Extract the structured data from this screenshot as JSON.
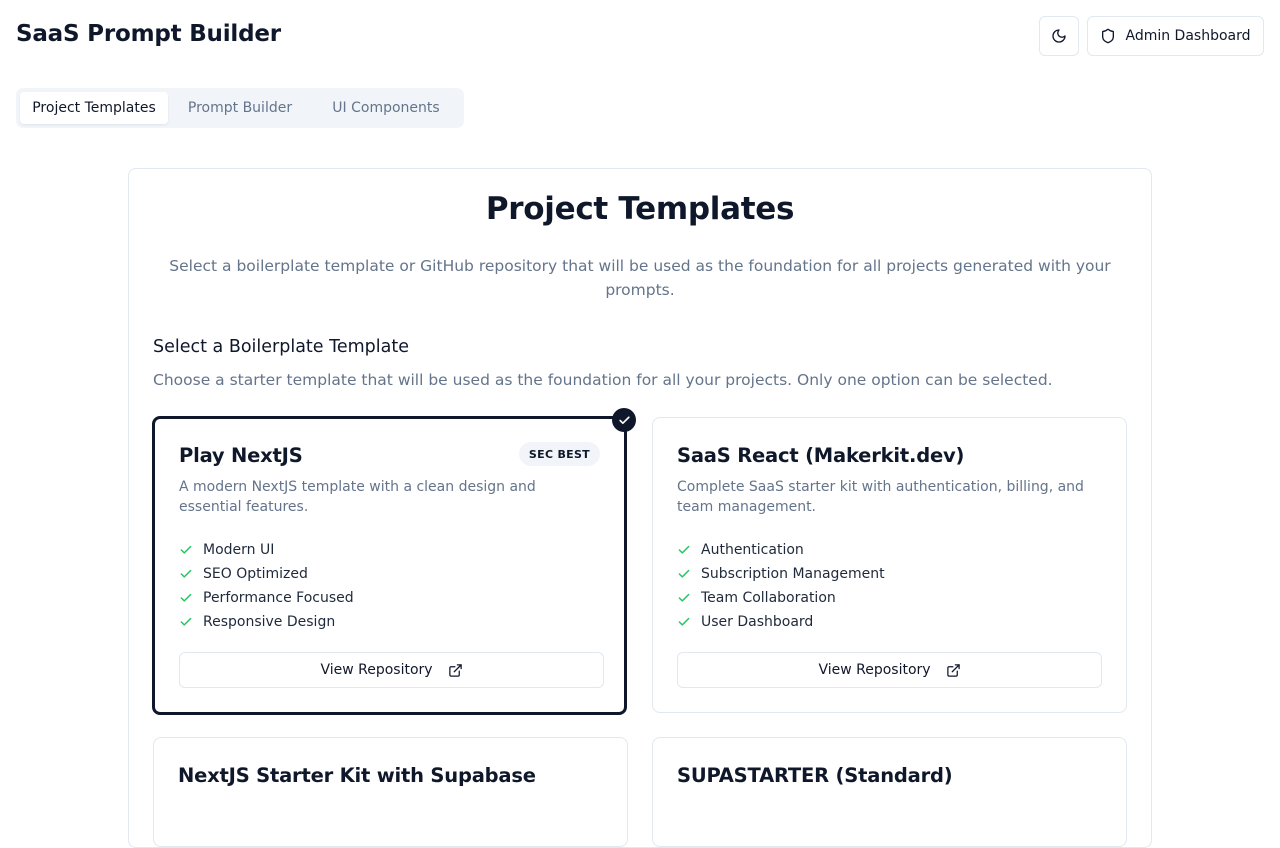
{
  "app": {
    "title": "SaaS Prompt Builder",
    "theme_toggle_icon": "moon-icon",
    "admin_button_label": "Admin Dashboard",
    "admin_button_icon": "shield-icon"
  },
  "tabs": [
    {
      "label": "Project Templates",
      "active": true
    },
    {
      "label": "Prompt Builder",
      "active": false
    },
    {
      "label": "UI Components",
      "active": false
    }
  ],
  "panel": {
    "title": "Project Templates",
    "description": "Select a boilerplate template or GitHub repository that will be used as the foundation for all projects generated with your prompts.",
    "section_title": "Select a Boilerplate Template",
    "section_description": "Choose a starter template that will be used as the foundation for all your projects. Only one option can be selected."
  },
  "templates": [
    {
      "name": "Play NextJS",
      "badge": "SEC BEST",
      "selected": true,
      "description": "A modern NextJS template with a clean design and essential features.",
      "features": [
        "Modern UI",
        "SEO Optimized",
        "Performance Focused",
        "Responsive Design"
      ],
      "button_label": "View Repository"
    },
    {
      "name": "SaaS React (Makerkit.dev)",
      "selected": false,
      "description": "Complete SaaS starter kit with authentication, billing, and team management.",
      "features": [
        "Authentication",
        "Subscription Management",
        "Team Collaboration",
        "User Dashboard"
      ],
      "button_label": "View Repository"
    },
    {
      "name": "NextJS Starter Kit with Supabase",
      "selected": false
    },
    {
      "name": "SUPASTARTER (Standard)",
      "selected": false
    }
  ],
  "colors": {
    "text_primary": "#0f172a",
    "text_muted": "#64748b",
    "border": "#e2e8f0",
    "tab_bg": "#f1f5f9",
    "check_green": "#22c55e",
    "selected_border": "#0f172a"
  }
}
